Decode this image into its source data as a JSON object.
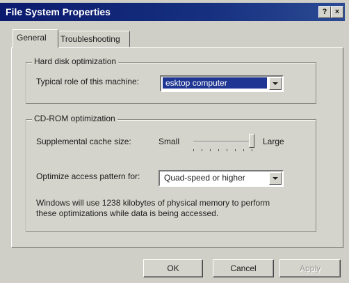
{
  "window": {
    "title": "File System Properties",
    "help_glyph": "?",
    "close_glyph": "×"
  },
  "tabs": [
    {
      "label": "General",
      "active": true
    },
    {
      "label": "Troubleshooting",
      "active": false
    }
  ],
  "hard_disk": {
    "legend": "Hard disk optimization",
    "role_label": "Typical role of this machine:",
    "role_value": "esktop computer"
  },
  "cdrom": {
    "legend": "CD-ROM optimization",
    "cache_label": "Supplemental cache size:",
    "slider_min_label": "Small",
    "slider_max_label": "Large",
    "slider_level": 1.0,
    "access_label": "Optimize access pattern for:",
    "access_value": "Quad-speed or higher",
    "info_line1": "Windows will use 1238 kilobytes of physical memory to perform",
    "info_line2": "these optimizations while data is being accessed."
  },
  "buttons": {
    "ok": "OK",
    "cancel": "Cancel",
    "apply": "Apply"
  },
  "colors": {
    "title_bar": "#16307f",
    "selection": "#1f3692",
    "face": "#d4d4cc"
  }
}
